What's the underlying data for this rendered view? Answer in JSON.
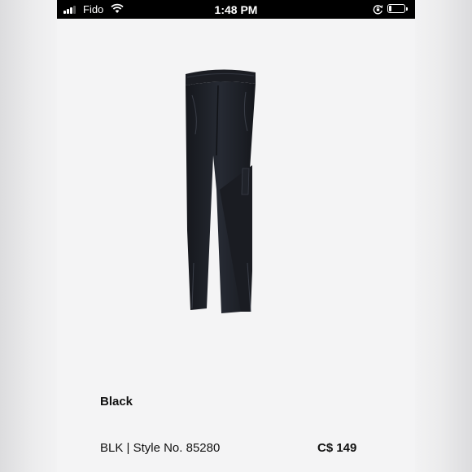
{
  "status_bar": {
    "carrier": "Fido",
    "time": "1:48 PM",
    "battery_level": 0.18,
    "signal_bars": 3
  },
  "product": {
    "image_icon": "pants-image",
    "variant_label": "Black",
    "style_line": "BLK | Style No. 85280",
    "price": "C$ 149"
  },
  "colors": {
    "status_bar_bg": "#000000",
    "page_bg": "#f4f4f5",
    "text": "#111111",
    "product_color": "#1c1e24"
  }
}
